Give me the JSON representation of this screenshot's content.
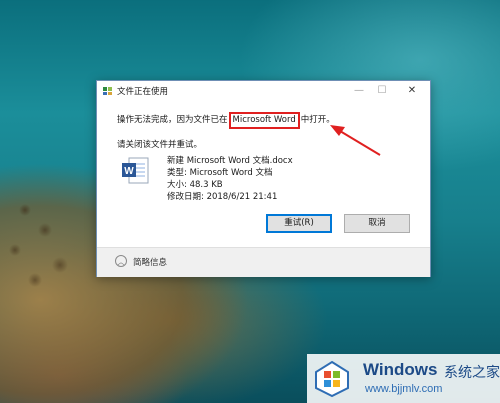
{
  "dialog": {
    "title": "文件正在使用",
    "controls": {
      "minimize": "—",
      "maximize": "☐",
      "close": "✕"
    },
    "message_prefix": "操作无法完成，因为文件已在",
    "message_app": "Microsoft Word",
    "message_suffix": "中打开。",
    "message2": "请关闭该文件并重试。",
    "file": {
      "name": "新建 Microsoft Word 文档.docx",
      "type": "类型: Microsoft Word 文档",
      "size": "大小: 48.3 KB",
      "modified": "修改日期: 2018/6/21 21:41"
    },
    "buttons": {
      "retry": "重试(R)",
      "cancel": "取消"
    },
    "footer": {
      "toggle_icon": "chevron-up-icon",
      "label": "简略信息"
    }
  },
  "watermark": {
    "brand": "Windows",
    "brand_cn": "系统之家",
    "url": "www.bjjmlv.com"
  },
  "colors": {
    "highlight_box": "#e02020",
    "arrow": "#e02020",
    "primary_button_border": "#0078d7"
  }
}
